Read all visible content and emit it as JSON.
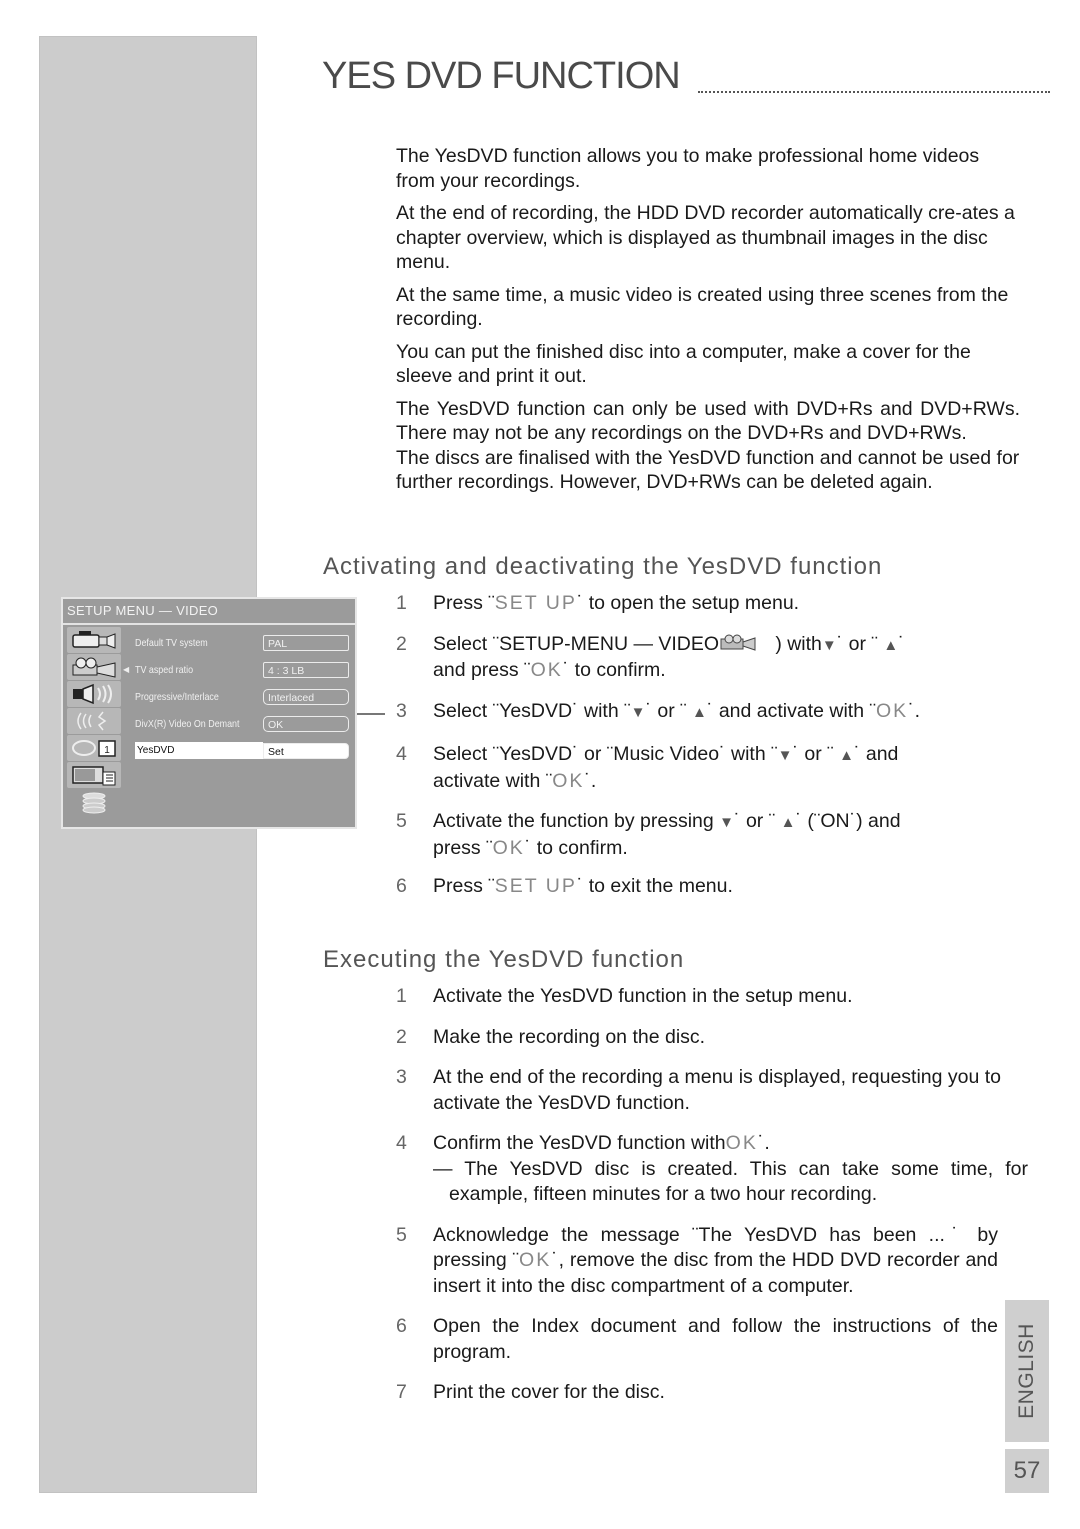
{
  "page": {
    "title": "YES DVD FUNCTION",
    "language_tab": "ENGLISH",
    "page_number": "57"
  },
  "intro": [
    "The YesDVD function allows you to make professional home videos from your recordings.",
    "At the end of recording, the HDD DVD recorder automatically cre-ates a chapter overview, which is displayed as thumbnail images in the disc menu.",
    "At the same time, a music video is created using three scenes from the recording.",
    "You can put the finished disc into a computer, make a cover for the sleeve and print it out.",
    "The YesDVD function can only be used with DVD+Rs and DVD+RWs. There may not be any recordings on the DVD+Rs and DVD+RWs.",
    "The discs are finalised with the YesDVD function and cannot be used for further recordings. However, DVD+RWs can be deleted again."
  ],
  "section_activate": {
    "heading": "Activating and deactivating the YesDVD function",
    "steps": [
      {
        "num": "1",
        "parts": [
          "Press ¨",
          "SET UP",
          "˙ to open the setup menu."
        ]
      },
      {
        "num": "2",
        "parts": [
          "Select ¨SETUP-MENU — VIDEO",
          ") with",
          "˙ or ¨ ",
          "˙",
          "and press ¨",
          "OK",
          "˙ to confirm."
        ]
      },
      {
        "num": "3",
        "parts": [
          "Select ¨YesDVD˙ with ¨",
          "˙ or ¨ ",
          "˙ and activate with ¨",
          "OK",
          "˙."
        ]
      },
      {
        "num": "4",
        "parts": [
          "Select ¨YesDVD˙ or ¨Music Video˙ with ¨",
          "˙ or ¨ ",
          "˙ and",
          "activate with ¨",
          "OK",
          "˙."
        ]
      },
      {
        "num": "5",
        "parts": [
          "Activate the function by pressing ",
          "˙ or ¨ ",
          "˙ (¨ON˙) and",
          "press ¨",
          "OK",
          "˙ to confirm."
        ]
      },
      {
        "num": "6",
        "parts": [
          "Press ¨",
          "SET UP",
          "˙ to exit the menu."
        ]
      }
    ]
  },
  "section_execute": {
    "heading": "Executing the YesDVD function",
    "steps": [
      {
        "num": "1",
        "text": "Activate the YesDVD function in the setup menu."
      },
      {
        "num": "2",
        "text": "Make the recording on the disc."
      },
      {
        "num": "3",
        "text": "At the end of the recording a menu is displayed, requesting you to activate the YesDVD function."
      },
      {
        "num": "4",
        "text_before": "Confirm the YesDVD function with",
        "key": "OK",
        "text_after": "˙.",
        "sub": "— The YesDVD disc is created. This can take some time, for example, fifteen minutes for a two hour recording."
      },
      {
        "num": "5",
        "text_before": "Acknowledge the message ¨The YesDVD has been ...˙ by pressing ¨",
        "key": "OK",
        "text_after": "˙, remove the disc from the HDD DVD recorder and insert it into the disc compartment of a computer."
      },
      {
        "num": "6",
        "text": "Open the  Index  document and follow the instructions of the program."
      },
      {
        "num": "7",
        "text": "Print the cover for the disc."
      }
    ]
  },
  "setup_menu": {
    "header": "SETUP MENU — VIDEO",
    "icons": [
      "camcorder-icon",
      "film-projector-icon",
      "speaker-icon",
      "signal-wave-icon",
      "timer-calendar-icon",
      "tv-remote-icon",
      "disc-stack-icon"
    ],
    "rows": [
      {
        "label": "Default TV system",
        "value": "PAL",
        "selected": false
      },
      {
        "label": "TV asped ratio",
        "value": "4 : 3 LB",
        "selected": false
      },
      {
        "label": "Progressive/Interlace",
        "value": "Interlaced",
        "selected": false
      },
      {
        "label": "DivX(R) Video On Demant",
        "value": "OK",
        "selected": false
      },
      {
        "label": "YesDVD",
        "value": "Set",
        "selected": true
      }
    ]
  },
  "symbols": {
    "down": "▼",
    "up": "▲"
  }
}
